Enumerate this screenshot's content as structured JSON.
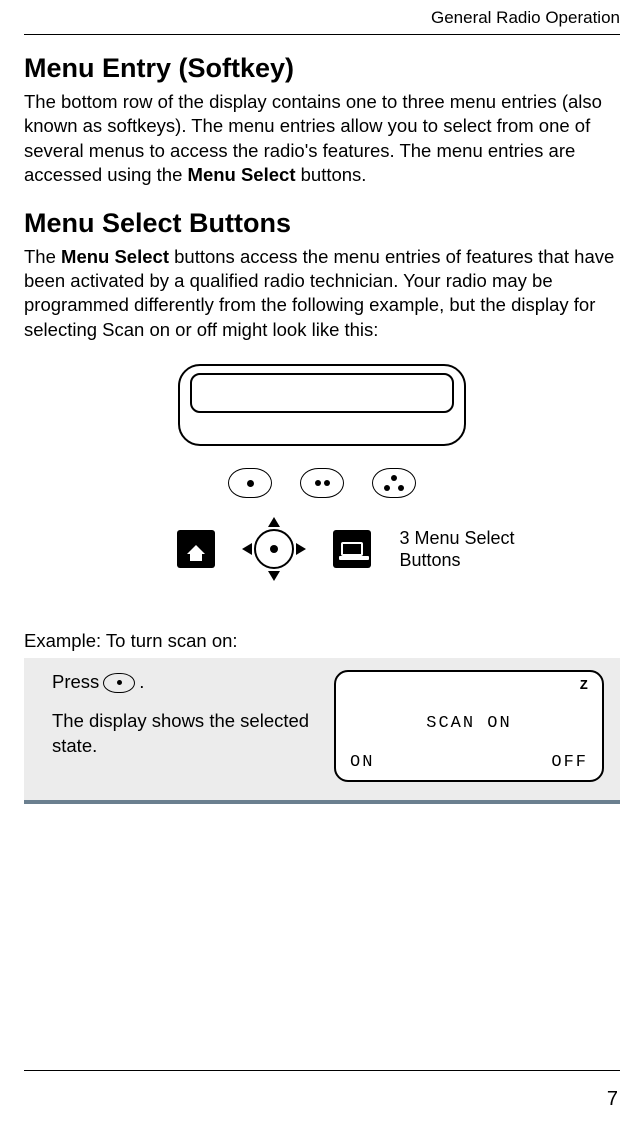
{
  "header": {
    "section_label": "General Radio Operation"
  },
  "sections": {
    "menu_entry": {
      "title": "Menu Entry (Softkey)",
      "body_parts": [
        "The bottom row of the display contains one to three menu entries (also known as softkeys). The menu entries allow you to select from one of several menus to access the radio's features. The menu entries are accessed using the ",
        "Menu Select",
        " buttons."
      ]
    },
    "menu_select": {
      "title": "Menu Select Buttons",
      "body_parts": [
        "The ",
        "Menu Select",
        " buttons access the menu entries of features that have been activated by a qualified radio technician. Your radio may be programmed differently from the following example, but the display for selecting Scan on or off might look like this:"
      ]
    }
  },
  "diagram": {
    "caption_line1": "3 Menu Select",
    "caption_line2": "Buttons"
  },
  "example": {
    "intro": "Example: To turn scan on:",
    "press_prefix": "Press ",
    "press_suffix": ".",
    "result_text": "The display shows the selected state.",
    "lcd": {
      "indicator": "Z",
      "center": "SCAN ON",
      "left_softkey": "ON",
      "right_softkey": "OFF"
    }
  },
  "footer": {
    "page_number": "7"
  }
}
